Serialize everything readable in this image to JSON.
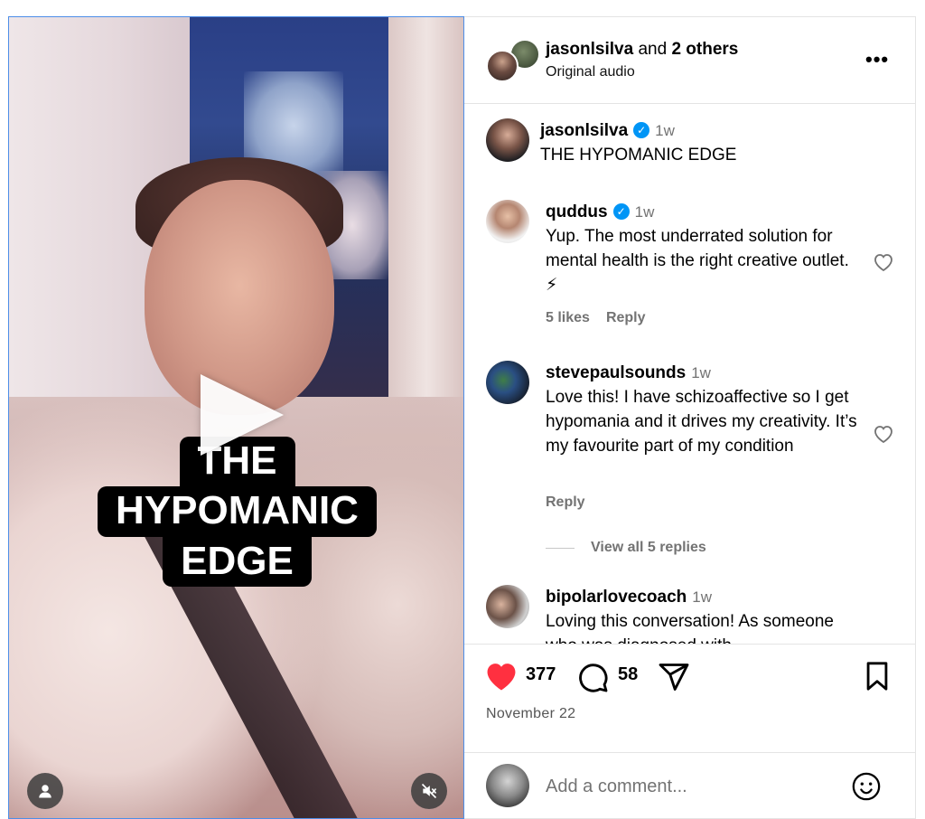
{
  "video": {
    "caption_lines": [
      "THE",
      "HYPOMANIC",
      "EDGE"
    ],
    "icons": {
      "play": "play-icon",
      "user": "user-icon",
      "mute": "muted-speaker-icon"
    }
  },
  "header": {
    "author": "jasonlsilva",
    "and_text": " and ",
    "others": "2 others",
    "audio": "Original audio",
    "more": "•••"
  },
  "comments": [
    {
      "user": "jasonlsilva",
      "verified": true,
      "time": "1w",
      "text": "THE HYPOMANIC EDGE"
    },
    {
      "user": "quddus",
      "verified": true,
      "time": "1w",
      "text": "Yup. The most underrated solution for mental health is the right creative outlet. ⚡",
      "likes": "5 likes",
      "reply": "Reply"
    },
    {
      "user": "stevepaulsounds",
      "verified": false,
      "time": "1w",
      "text": "Love this! I have schizoaffective so I get hypomania and it drives my creativity. It’s my favourite part of my condition",
      "reply": "Reply",
      "view_replies": "View all 5 replies"
    },
    {
      "user": "bipolarlovecoach",
      "verified": false,
      "time": "1w",
      "text": "Loving this conversation! As someone who was diagnosed with"
    }
  ],
  "actions": {
    "likes_count": "377",
    "comments_count": "58",
    "date": "November 22",
    "colors": {
      "liked_heart": "#ff3040",
      "verified": "#0095f6"
    }
  },
  "composer": {
    "placeholder": "Add a comment..."
  }
}
